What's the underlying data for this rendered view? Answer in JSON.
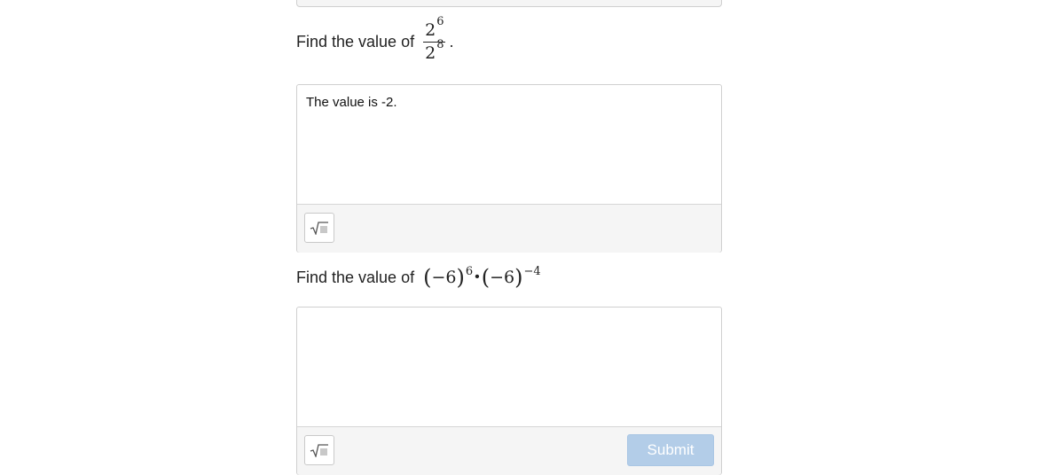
{
  "question1": {
    "prompt": "Find the value of",
    "numerator_base": "2",
    "numerator_exponent": "6",
    "denominator_base": "2",
    "denominator_exponent": "8",
    "trailing": "."
  },
  "answer1": {
    "text": "The value is -2.",
    "math_button_icon": "square-root-icon"
  },
  "question2": {
    "prompt": "Find the value of",
    "left_paren": "(",
    "right_paren": ")",
    "base1": "−6",
    "exponent1": "6",
    "operator": "•",
    "base2": "−6",
    "exponent2": "−4"
  },
  "answer2": {
    "text": "",
    "math_button_icon": "square-root-icon",
    "submit_label": "Submit"
  },
  "colors": {
    "submit_disabled_bg": "#b3cde8",
    "border": "#cfcfcf",
    "toolbar_bg": "#f5f5f5"
  }
}
